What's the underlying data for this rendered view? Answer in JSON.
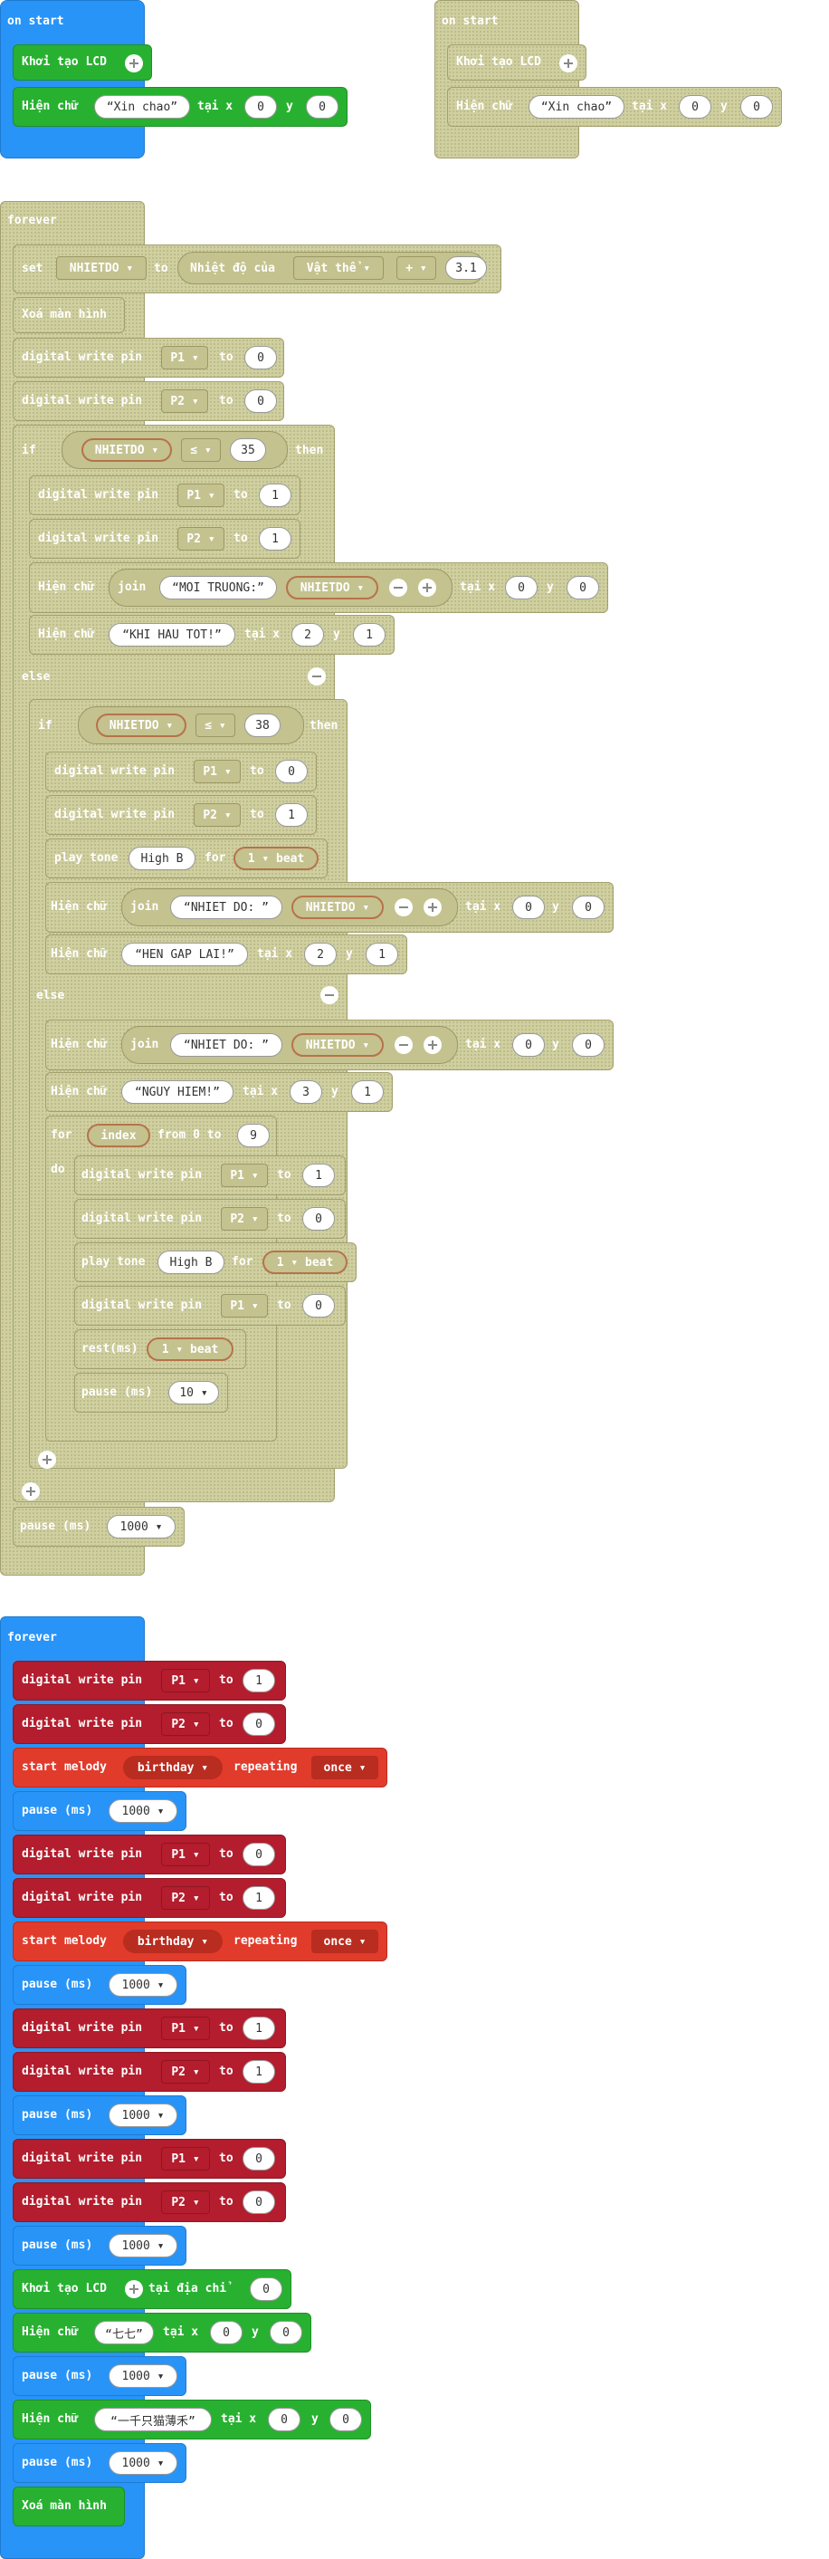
{
  "colors": {
    "event_blue": "#2894f8",
    "lcd_green": "#28b131",
    "pins_red": "#b31d2d",
    "music_red": "#e13b2c",
    "disabled_tan": "#cfcfa0"
  },
  "on_start_1": {
    "header": "on start",
    "init": "Khởi tạo LCD",
    "show_label": "Hiện chữ",
    "show_text": "Xin chao",
    "at_x": "tại x",
    "x": "0",
    "y_label": "y",
    "y": "0"
  },
  "on_start_2": {
    "header": "on start",
    "init": "Khởi tạo LCD",
    "show_label": "Hiện chữ",
    "show_text": "Xin chao",
    "at_x": "tại x",
    "x": "0",
    "y_label": "y",
    "y": "0"
  },
  "forever1": {
    "header": "forever",
    "set": {
      "label": "set",
      "var": "NHIETDO",
      "to": "to",
      "sensor": "Nhiệt độ của",
      "object": "Vật thể",
      "op": "+",
      "num": "3.1"
    },
    "clear": "Xoá màn hình",
    "dw": "digital write pin",
    "to": "to",
    "p1": "P1",
    "p2": "P2",
    "v0": "0",
    "v1": "1",
    "if": "if",
    "then": "then",
    "else": "else",
    "lt": "≤",
    "n35": "35",
    "n38": "38",
    "show": "Hiện chữ",
    "join": "join",
    "at_x": "tại x",
    "y_label": "y",
    "moi_truong": "MOI TRUONG:",
    "khi_hau": "KHI HAU TOT!",
    "nhiet_do": "NHIET DO: ",
    "hen_gap": "HEN GAP LAI!",
    "nguy_hiem": "NGUY HIEM!",
    "x2": "2",
    "x3": "3",
    "play_tone": "play tone",
    "high_b": "High B",
    "for": "for",
    "beat": "1 ▾ beat",
    "loop_for": "for",
    "index": "index",
    "from_to": "from 0 to",
    "n9": "9",
    "do": "do",
    "rest": "rest(ms)",
    "pause": "pause (ms)",
    "p10": "10",
    "p1000": "1000",
    "var": "NHIETDO"
  },
  "forever2": {
    "header": "forever",
    "dw": "digital write pin",
    "to": "to",
    "p1": "P1",
    "p2": "P2",
    "v0": "0",
    "v1": "1",
    "start_melody": "start melody",
    "melody": "birthday",
    "repeating": "repeating",
    "once": "once",
    "pause": "pause (ms)",
    "p1000": "1000",
    "init_addr": "Khởi tạo LCD",
    "at_addr": "tại địa chỉ",
    "addr": "0",
    "show": "Hiện chữ",
    "at_x": "tại x",
    "y_label": "y",
    "x0": "0",
    "y0": "0",
    "text_qq": "七七",
    "text_cn": "一千只猫薄禾",
    "clear": "Xoá màn hình"
  }
}
